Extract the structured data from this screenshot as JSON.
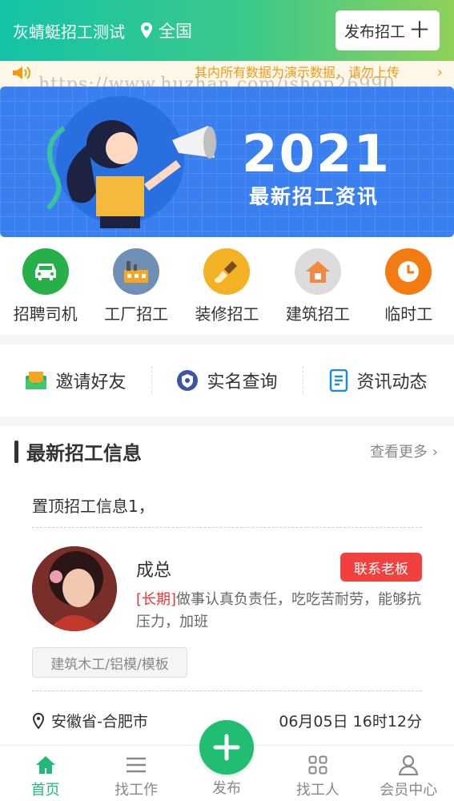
{
  "header": {
    "app_title": "灰蜻蜓招工测试",
    "location": "全国",
    "post_button": "发布招工"
  },
  "notice": {
    "text": "其内所有数据为演示数据，请勿上传",
    "watermark": "https://www.huzhan.com/ishop26990"
  },
  "banner": {
    "year": "2021",
    "slogan": "最新招工资讯"
  },
  "categories": [
    {
      "label": "招聘司机",
      "color": "#27b04a"
    },
    {
      "label": "工厂招工",
      "color": "#6f8fb4"
    },
    {
      "label": "装修招工",
      "color": "#f2b224"
    },
    {
      "label": "建筑招工",
      "color": "#dcdcdc"
    },
    {
      "label": "临时工",
      "color": "#f27b12"
    }
  ],
  "shortcuts": [
    {
      "label": "邀请好友"
    },
    {
      "label": "实名查询"
    },
    {
      "label": "资讯动态"
    }
  ],
  "jobs": {
    "section_title": "最新招工信息",
    "more_label": "查看更多",
    "pinned": "置顶招工信息1，",
    "item": {
      "name": "成总",
      "contact_label": "联系老板",
      "tag": "[长期]",
      "description": "做事认真负责任，吃吃苦耐劳，能够抗压力，加班",
      "category": "建筑木工/铝模/模板",
      "location": "安徽省-合肥市",
      "time": "06月05日 16时12分"
    }
  },
  "tabbar": {
    "tabs": [
      {
        "label": "首页",
        "active": true
      },
      {
        "label": "找工作",
        "active": false
      },
      {
        "label": "发布",
        "active": false
      },
      {
        "label": "找工人",
        "active": false
      },
      {
        "label": "会员中心",
        "active": false
      }
    ],
    "accent": "#1fb97a"
  }
}
